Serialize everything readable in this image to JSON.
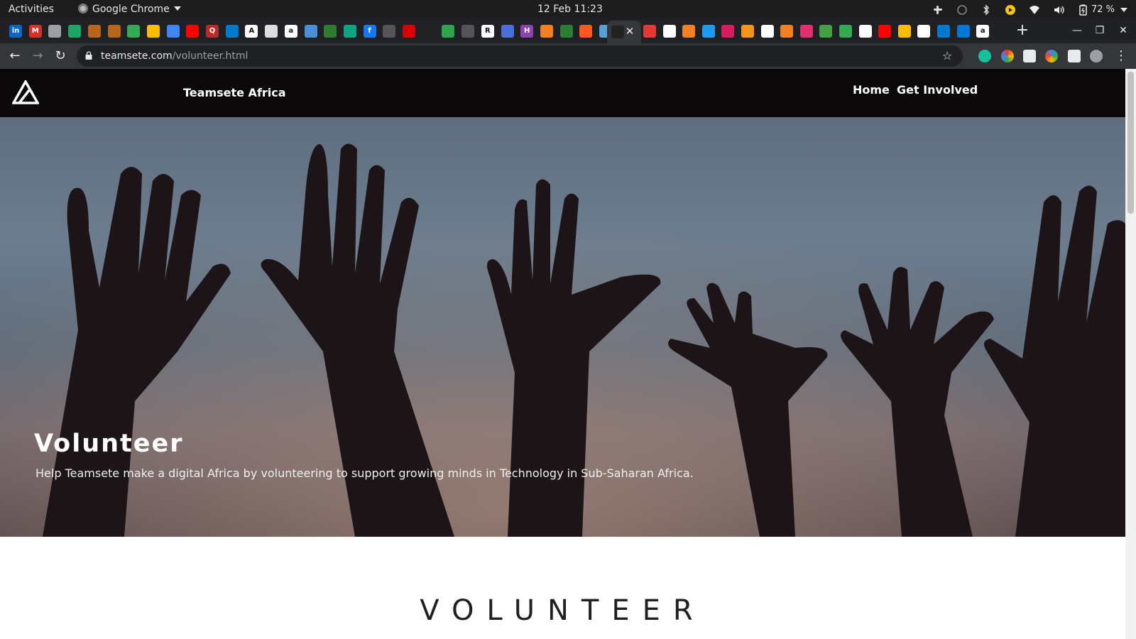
{
  "os_bar": {
    "activities": "Activities",
    "app_name": "Google Chrome",
    "clock": "12 Feb  11:23",
    "battery": "72 %"
  },
  "browser": {
    "url_domain": "teamsete.com",
    "url_path": "/volunteer.html",
    "tab_favicons": [
      {
        "icon": "linkedin-icon",
        "color": "#0a66c2",
        "glyph": "in"
      },
      {
        "icon": "gmail-icon",
        "color": "#d93025",
        "glyph": "M"
      },
      {
        "icon": "globe-icon",
        "color": "#9aa0a6",
        "glyph": ""
      },
      {
        "icon": "google-drive-icon",
        "color": "#1fa463",
        "glyph": ""
      },
      {
        "icon": "hand-icon",
        "color": "#b5651d",
        "glyph": ""
      },
      {
        "icon": "hand-icon",
        "color": "#b5651d",
        "glyph": ""
      },
      {
        "icon": "chart-icon",
        "color": "#34a853",
        "glyph": ""
      },
      {
        "icon": "google-drive-icon",
        "color": "#fbbc04",
        "glyph": ""
      },
      {
        "icon": "google-drive-icon",
        "color": "#4285f4",
        "glyph": ""
      },
      {
        "icon": "youtube-icon",
        "color": "#ff0000",
        "glyph": ""
      },
      {
        "icon": "quora-icon",
        "color": "#b92b27",
        "glyph": "Q"
      },
      {
        "icon": "vscode-icon",
        "color": "#007acc",
        "glyph": ""
      },
      {
        "icon": "dictionary-icon",
        "color": "#ffffff",
        "glyph": "A"
      },
      {
        "icon": "news-icon",
        "color": "#dddddd",
        "glyph": ""
      },
      {
        "icon": "amazon-icon",
        "color": "#ffffff",
        "glyph": "a"
      },
      {
        "icon": "sync-icon",
        "color": "#4a90d9",
        "glyph": ""
      },
      {
        "icon": "tree-icon",
        "color": "#2e7d32",
        "glyph": ""
      },
      {
        "icon": "shield-icon",
        "color": "#10a37f",
        "glyph": ""
      },
      {
        "icon": "facebook-icon",
        "color": "#1877f2",
        "glyph": "f"
      },
      {
        "icon": "github-icon",
        "color": "#555555",
        "glyph": ""
      },
      {
        "icon": "arsenal-icon",
        "color": "#db0007",
        "glyph": ""
      },
      {
        "icon": "teamsete-icon",
        "color": "#222222",
        "glyph": ""
      },
      {
        "icon": "code-icon",
        "color": "#2ea44f",
        "glyph": ""
      },
      {
        "icon": "github-icon",
        "color": "#555555",
        "glyph": ""
      },
      {
        "icon": "r-icon",
        "color": "#ffffff",
        "glyph": "R"
      },
      {
        "icon": "moon-icon",
        "color": "#4a6fd9",
        "glyph": ""
      },
      {
        "icon": "h-icon",
        "color": "#8e44ad",
        "glyph": "H"
      },
      {
        "icon": "stack-overflow-icon",
        "color": "#f48024",
        "glyph": ""
      },
      {
        "icon": "chart-line-icon",
        "color": "#2e7d32",
        "glyph": ""
      },
      {
        "icon": "link-icon",
        "color": "#ff5722",
        "glyph": ""
      },
      {
        "icon": "cloud-icon",
        "color": "#5ca0d9",
        "glyph": ""
      },
      {
        "icon": "settings-icon",
        "color": "#e53935",
        "glyph": ""
      },
      {
        "icon": "globe-icon",
        "color": "#ffffff",
        "glyph": ""
      },
      {
        "icon": "stack-overflow-icon",
        "color": "#f48024",
        "glyph": ""
      },
      {
        "icon": "x-icon",
        "color": "#1d9bf0",
        "glyph": ""
      },
      {
        "icon": "w-icon",
        "color": "#d81b60",
        "glyph": ""
      },
      {
        "icon": "bitcoin-icon",
        "color": "#f7931a",
        "glyph": ""
      },
      {
        "icon": "globe-icon",
        "color": "#ffffff",
        "glyph": ""
      },
      {
        "icon": "stack-overflow-icon",
        "color": "#f48024",
        "glyph": ""
      },
      {
        "icon": "instagram-icon",
        "color": "#e1306c",
        "glyph": ""
      },
      {
        "icon": "puzzle-icon",
        "color": "#43a047",
        "glyph": ""
      },
      {
        "icon": "chart-icon",
        "color": "#34a853",
        "glyph": ""
      },
      {
        "icon": "globe-icon",
        "color": "#ffffff",
        "glyph": ""
      },
      {
        "icon": "youtube-icon",
        "color": "#ff0000",
        "glyph": ""
      },
      {
        "icon": "books-icon",
        "color": "#fbbc04",
        "glyph": ""
      },
      {
        "icon": "globe-icon",
        "color": "#ffffff",
        "glyph": ""
      },
      {
        "icon": "vscode-icon",
        "color": "#007acc",
        "glyph": ""
      },
      {
        "icon": "outlook-icon",
        "color": "#0078d4",
        "glyph": ""
      },
      {
        "icon": "amazon-icon",
        "color": "#ffffff",
        "glyph": "a"
      }
    ]
  },
  "site": {
    "brand": "Teamsete Africa",
    "nav": {
      "home": "Home",
      "get_involved": "Get Involved"
    },
    "hero": {
      "title": "Volunteer",
      "subtitle": "Help Teamsete make a digital Africa by volunteering to support growing minds in Technology in Sub-Saharan Africa."
    },
    "section_heading": "VOLUNTEER"
  },
  "colors": {
    "nav_bg": "#0b0809",
    "hero_sky": "#6d7d8e",
    "heading_text": "#1f1f24"
  }
}
